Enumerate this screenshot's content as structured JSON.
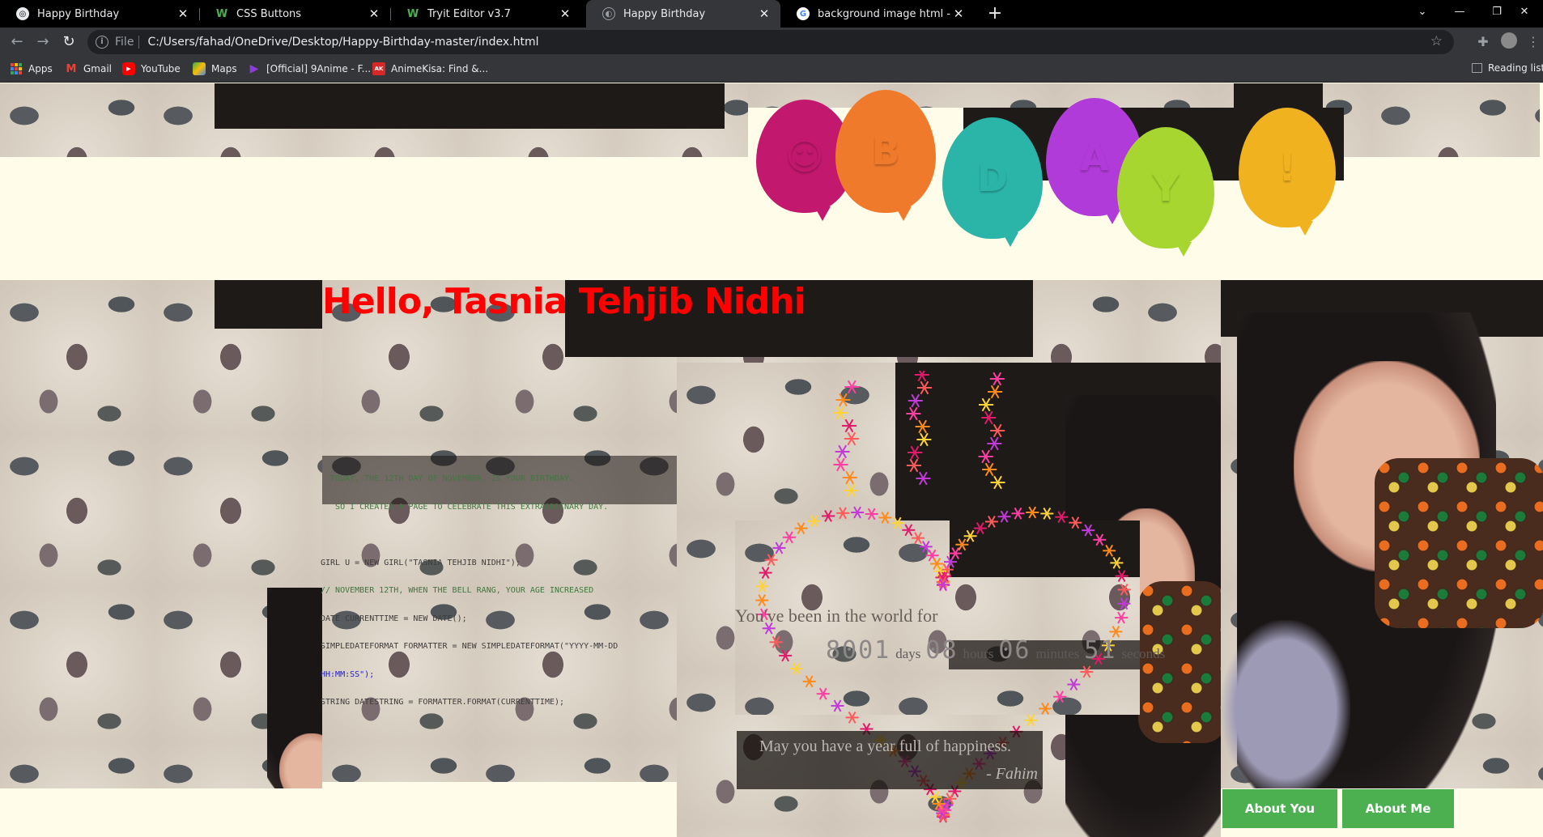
{
  "browser": {
    "tabs": [
      {
        "title": "Happy Birthday",
        "icon": "chrome-icon",
        "active": false
      },
      {
        "title": "CSS Buttons",
        "icon": "w3schools-icon",
        "active": false
      },
      {
        "title": "Tryit Editor v3.7",
        "icon": "w3schools-icon",
        "active": false
      },
      {
        "title": "Happy Birthday",
        "icon": "globe-icon",
        "active": true
      },
      {
        "title": "background image html - Google",
        "icon": "google-icon",
        "active": false
      }
    ],
    "new_tab_label": "+",
    "address": {
      "scheme": "File",
      "url": "C:/Users/fahad/OneDrive/Desktop/Happy-Birthday-master/index.html"
    },
    "bookmarks": [
      {
        "label": "Apps",
        "icon": "apps-grid-icon"
      },
      {
        "label": "Gmail",
        "icon": "gmail-icon"
      },
      {
        "label": "YouTube",
        "icon": "youtube-icon"
      },
      {
        "label": "Maps",
        "icon": "maps-icon"
      },
      {
        "label": "[Official] 9Anime - F...",
        "icon": "9anime-icon"
      },
      {
        "label": "AnimeKisa: Find &...",
        "icon": "animekisa-icon"
      }
    ],
    "reading_list_label": "Reading list",
    "colors": {
      "tabbar": "#000000",
      "toolbar": "#35363a",
      "omnibox": "#202124"
    }
  },
  "page": {
    "balloons": [
      {
        "letter": "☺",
        "color": "#c2186d"
      },
      {
        "letter": "B",
        "color": "#f07a2c"
      },
      {
        "letter": "D",
        "color": "#2bb4a8"
      },
      {
        "letter": "A",
        "color": "#b13bd8"
      },
      {
        "letter": "Y",
        "color": "#a6d62f"
      },
      {
        "letter": "!",
        "color": "#f0b21f"
      }
    ],
    "greeting": "Hello, Tasnia Tehjib Nidhi",
    "greeting_color": "#ff0000",
    "code_lines": [
      "  TODAY, THE 12TH DAY OF NOVEMBER, IS YOUR BIRTHDAY.",
      "   SO I CREATED A PAGE TO CELEBRATE THIS EXTRAORDINARY DAY.",
      "",
      "GIRL U = NEW GIRL(\"TASNIA TEHJIB NIDHI\");",
      "// NOVEMBER 12TH, WHEN THE BELL RANG, YOUR AGE INCREASED",
      "DATE CURRENTTIME = NEW DATE();",
      "SIMPLEDATEFORMAT FORMATTER = NEW SIMPLEDATEFORMAT(\"YYYY-MM-DD",
      "HH:MM:SS\");",
      "STRING DATESTRING = FORMATTER.FORMAT(CURRENTTIME);"
    ],
    "timer": {
      "label": "You've been in the world for",
      "days": "8001",
      "days_unit": "days",
      "hours": "08",
      "hours_unit": "hours",
      "minutes": "06",
      "minutes_unit": "minutes",
      "seconds": "51",
      "seconds_unit": "seconds"
    },
    "quote": {
      "text": "May you have a year full of happiness.",
      "signature": "- Fahim"
    },
    "buttons": {
      "about_you": "About You",
      "about_me": "About Me",
      "color": "#4caf50"
    }
  }
}
